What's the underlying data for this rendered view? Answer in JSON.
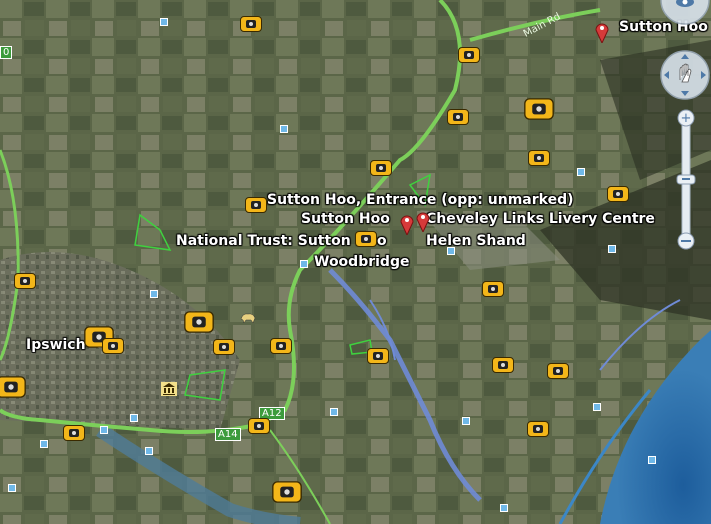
{
  "labels": {
    "sutton_hoo_top": "Sutton Hoo",
    "entrance": "Sutton Hoo, Entrance (opp: unmarked)",
    "sutton_hoo": "Sutton Hoo",
    "cheveley": "Cheveley Links Livery Centre",
    "national_trust": "National Trust: Sutton Hoo",
    "helen_shand": "Helen Shand",
    "woodbridge": "Woodbridge",
    "ipswich": "Ipswich"
  },
  "roads": {
    "main_rd": "Main Rd",
    "a12": "A12",
    "a14": "A14",
    "edge_marker": "0"
  },
  "colors": {
    "road": "#7ccf5a",
    "river": "#6f8bd6",
    "sea": "#2e6fa6",
    "photo_icon": "#f3b619",
    "pin": "#d63a3a"
  },
  "controls": {
    "icons": [
      "look-around-icon",
      "pan-hand-icon",
      "zoom-in-icon",
      "zoom-out-icon"
    ],
    "zoom_in": "+",
    "zoom_out": "−"
  }
}
